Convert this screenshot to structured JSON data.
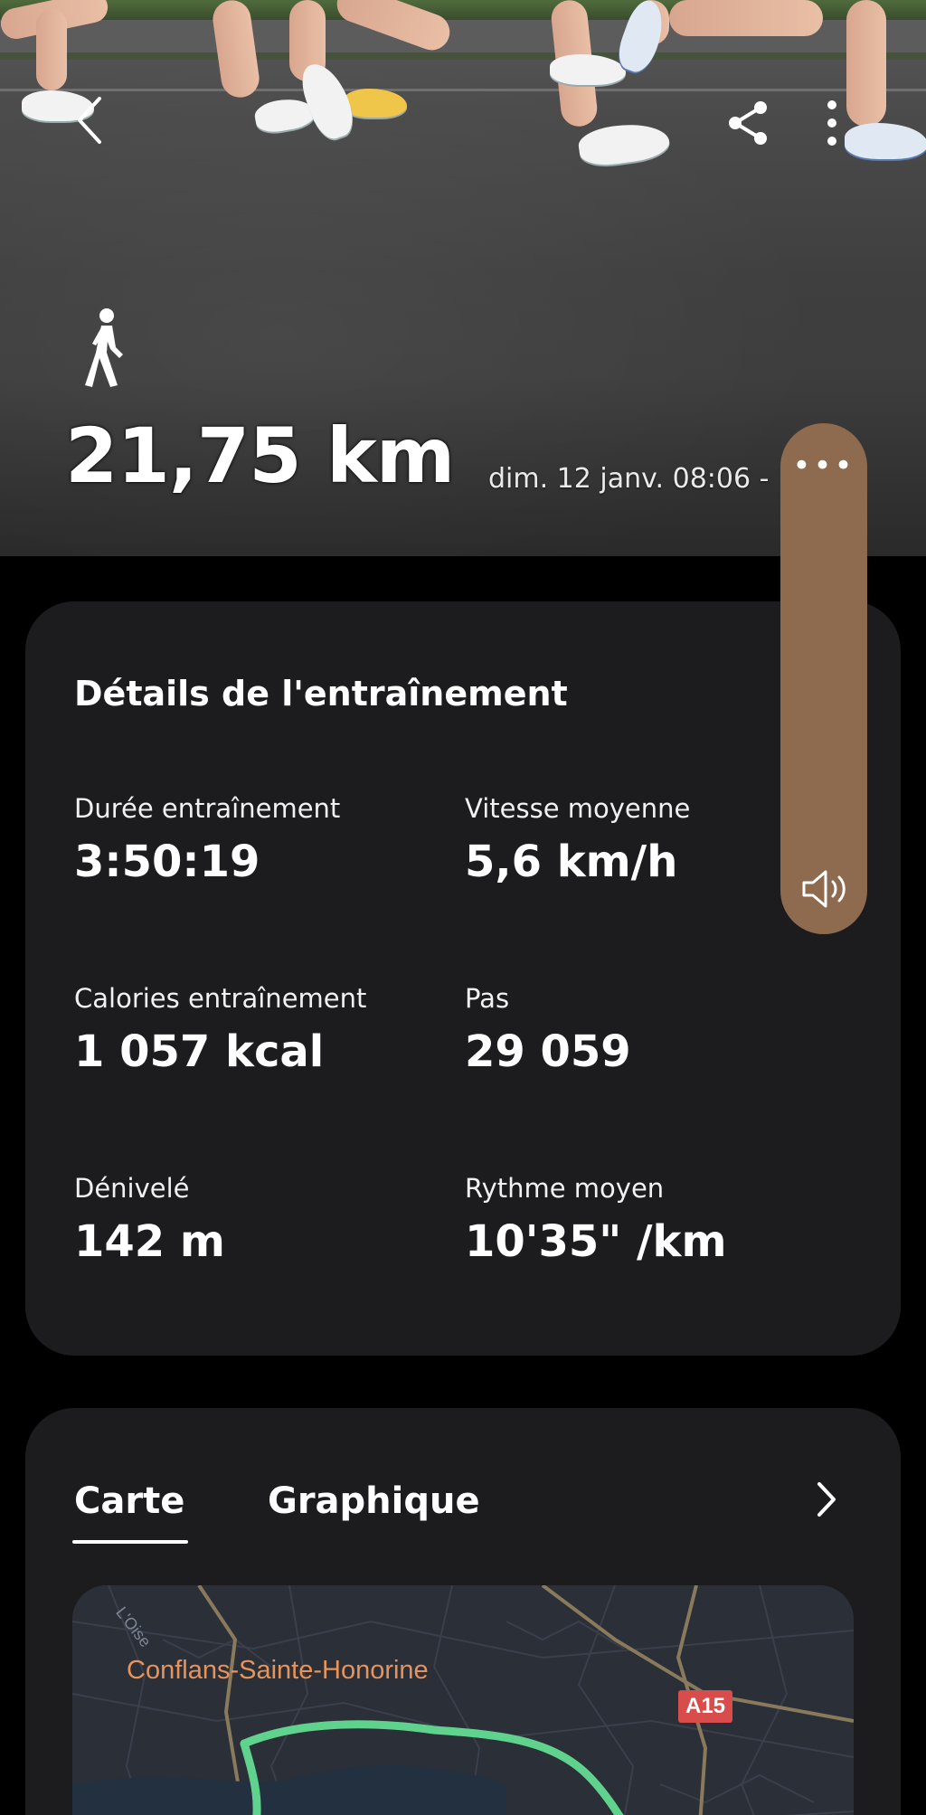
{
  "hero": {
    "activity_icon": "walking-person-icon",
    "distance": "21,75 km",
    "date_time": "dim. 12 janv. 08:06 -"
  },
  "toolbar": {
    "back_icon": "chevron-left-icon",
    "share_icon": "share-icon",
    "more_icon": "vertical-dots-icon"
  },
  "volume_panel": {
    "menu_dots": "•••",
    "speaker_icon": "speaker-icon",
    "color": "#8e6a4e"
  },
  "details": {
    "title": "Détails de l'entraînement",
    "stats": [
      {
        "label": "Durée entraînement",
        "value": "3:50:19"
      },
      {
        "label": "Vitesse moyenne",
        "value": "5,6 km/h"
      },
      {
        "label": "Calories entraînement",
        "value": "1 057 kcal"
      },
      {
        "label": "Pas",
        "value": "29 059"
      },
      {
        "label": "Dénivelé",
        "value": "142 m"
      },
      {
        "label": "Rythme moyen",
        "value": "10'35\" /km"
      }
    ]
  },
  "map_card": {
    "tabs": [
      {
        "label": "Carte",
        "active": true
      },
      {
        "label": "Graphique",
        "active": false
      }
    ],
    "chevron_icon": "chevron-right-icon",
    "city_label": "Conflans-Sainte-Honorine",
    "river_label": "L'Oise",
    "road_badge": "A15",
    "route_color": "#5fd38d",
    "city_label_color": "#e7935a"
  }
}
